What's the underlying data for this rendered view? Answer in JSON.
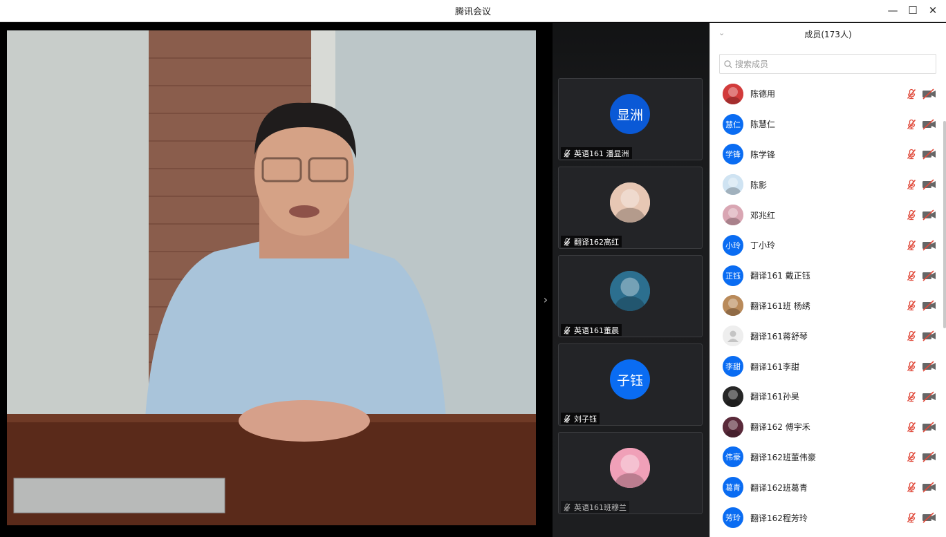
{
  "window": {
    "title": "腾讯会议",
    "minimize_glyph": "—",
    "maximize_glyph": "☐",
    "close_glyph": "✕"
  },
  "stage": {
    "collapse_glyph": "›",
    "thumbnails": [
      {
        "name": "英语161 潘显洲",
        "avatar_text": "显洲",
        "avatar_type": "text",
        "avatar_color": "#0a59d6",
        "muted": true,
        "speaking_highlight": false
      },
      {
        "name": "翻译162高红",
        "avatar_text": "",
        "avatar_type": "image-pink-dog",
        "avatar_color": "#e7c7b4",
        "muted": true,
        "speaking_highlight": false
      },
      {
        "name": "英语161董晨",
        "avatar_text": "",
        "avatar_type": "image-toy-robot",
        "avatar_color": "#2c6f8f",
        "muted": true,
        "speaking_highlight": false
      },
      {
        "name": "刘子钰",
        "avatar_text": "子钰",
        "avatar_type": "text",
        "avatar_color": "#0a6cf2",
        "muted": true,
        "speaking_highlight": false
      },
      {
        "name": "英语161班穆兰",
        "avatar_text": "",
        "avatar_type": "image-anime-girl",
        "avatar_color": "#f0a0b8",
        "muted": true,
        "speaking_highlight": false
      }
    ]
  },
  "members_panel": {
    "header": "成员(173人)",
    "header_chevron": "⌄",
    "search_placeholder": "搜索成员",
    "search_icon": "search-icon",
    "mic_icon": "mic-muted-icon",
    "camera_icon": "camera-off-icon",
    "muted_color": "#e0493a",
    "members": [
      {
        "name": "陈德用",
        "avatar_text": "",
        "avatar_type": "image-red-group",
        "avatar_color": "#d23b3b"
      },
      {
        "name": "陈慧仁",
        "avatar_text": "慧仁",
        "avatar_type": "text",
        "avatar_color": "#0a6cf2"
      },
      {
        "name": "陈学锋",
        "avatar_text": "学锋",
        "avatar_type": "text",
        "avatar_color": "#0a6cf2"
      },
      {
        "name": "陈影",
        "avatar_text": "",
        "avatar_type": "image-flower-girl",
        "avatar_color": "#cfe3f2"
      },
      {
        "name": "邓兆红",
        "avatar_text": "",
        "avatar_type": "image-blossom",
        "avatar_color": "#d9a6b3"
      },
      {
        "name": "丁小玲",
        "avatar_text": "小玲",
        "avatar_type": "text",
        "avatar_color": "#0a6cf2"
      },
      {
        "name": "翻译161 戴正钰",
        "avatar_text": "正钰",
        "avatar_type": "text",
        "avatar_color": "#0a6cf2"
      },
      {
        "name": "翻译161班  杨绣",
        "avatar_text": "",
        "avatar_type": "image-portrait",
        "avatar_color": "#b98a5a"
      },
      {
        "name": "翻译161蒋舒琴",
        "avatar_text": "",
        "avatar_type": "default-person",
        "avatar_color": "#eeeeee"
      },
      {
        "name": "翻译161李甜",
        "avatar_text": "李甜",
        "avatar_type": "text",
        "avatar_color": "#0a6cf2"
      },
      {
        "name": "翻译161孙昊",
        "avatar_text": "",
        "avatar_type": "image-dark-heart",
        "avatar_color": "#262626"
      },
      {
        "name": "翻译162 傅宇禾",
        "avatar_text": "",
        "avatar_type": "image-anime",
        "avatar_color": "#5a2a3a"
      },
      {
        "name": "翻译162班董伟豪",
        "avatar_text": "伟豪",
        "avatar_type": "text",
        "avatar_color": "#0a6cf2"
      },
      {
        "name": "翻译162班葛青",
        "avatar_text": "葛青",
        "avatar_type": "text",
        "avatar_color": "#0a6cf2"
      },
      {
        "name": "翻译162程芳玲",
        "avatar_text": "芳玲",
        "avatar_type": "text",
        "avatar_color": "#0a6cf2"
      }
    ]
  }
}
